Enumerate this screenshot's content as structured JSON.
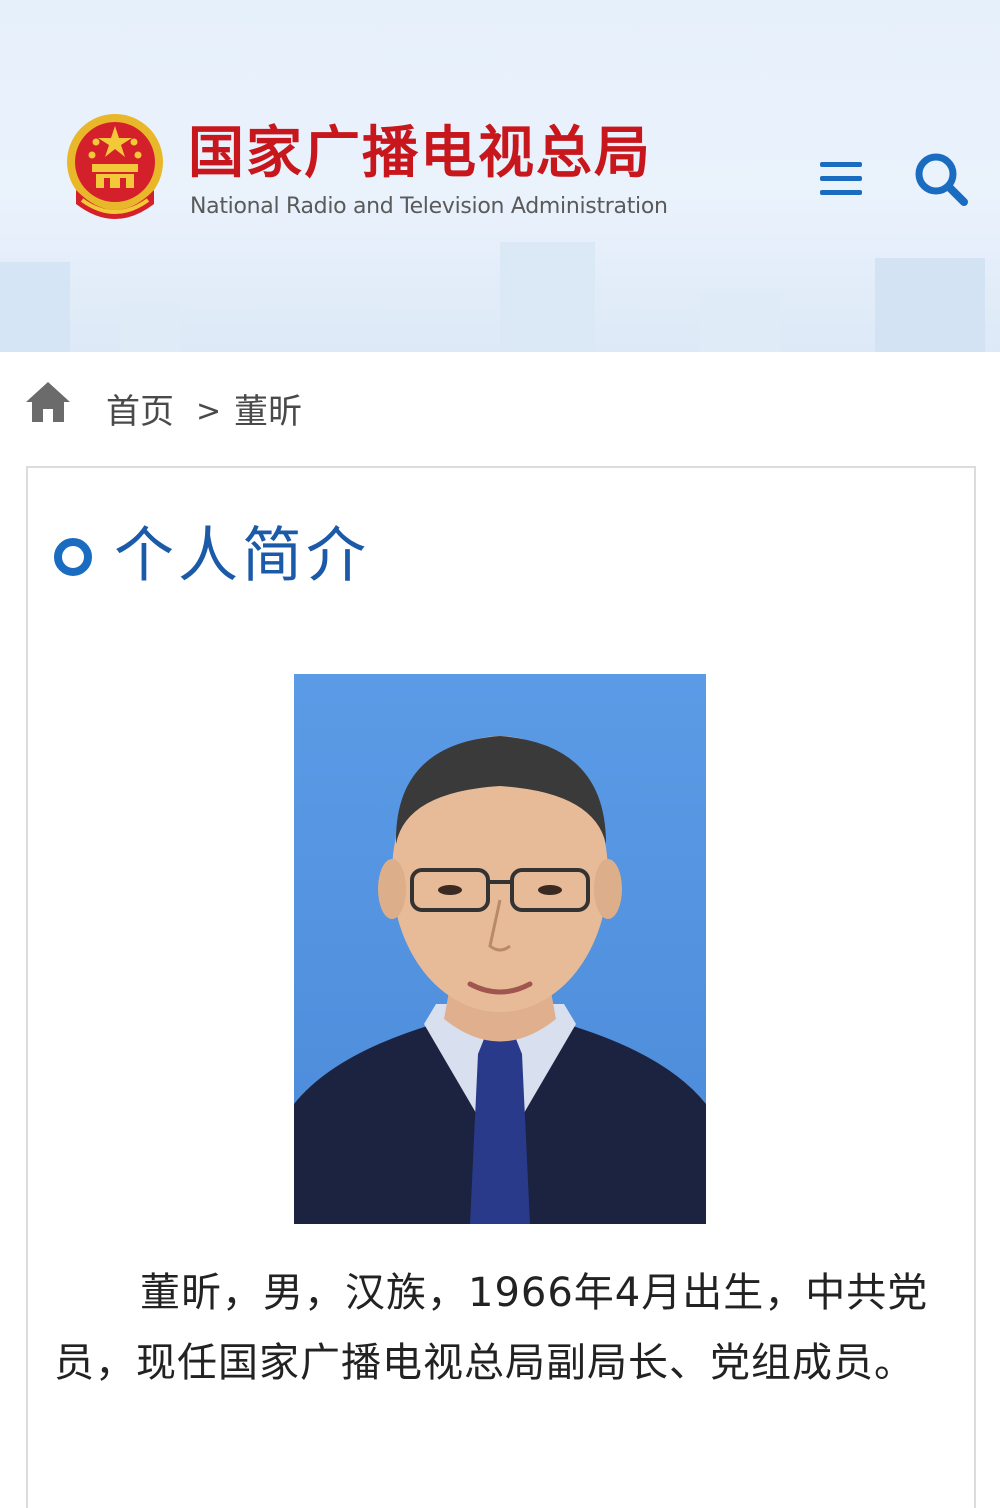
{
  "header": {
    "title": "国家广播电视总局",
    "subtitle": "National Radio and Television Administration",
    "emblem_icon": "national-emblem-icon",
    "menu_icon": "menu-icon",
    "search_icon": "search-icon",
    "colors": {
      "brand_red": "#c8161d",
      "accent_blue": "#1a6cc0"
    }
  },
  "breadcrumb": {
    "home_icon": "home-icon",
    "home_label": "首页",
    "separator": ">",
    "current": "董昕"
  },
  "section": {
    "icon": "ring-icon",
    "title": "个人简介"
  },
  "profile": {
    "photo_icon": "portrait-photo",
    "bio": "董昕，男，汉族，1966年4月出生，中共党员，现任国家广播电视总局副局长、党组成员。"
  }
}
